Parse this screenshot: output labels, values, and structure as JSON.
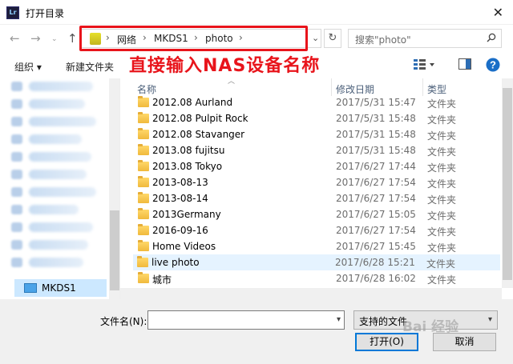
{
  "window": {
    "title": "打开目录",
    "app_icon_text": "Lr"
  },
  "nav": {
    "breadcrumb": [
      "网络",
      "MKDS1",
      "photo"
    ],
    "search_placeholder": "搜索\"photo\""
  },
  "toolbar": {
    "organize": "组织 ▾",
    "new_folder": "新建文件夹",
    "annotation": "直接输入NAS设备名称"
  },
  "sidebar": {
    "selected_item": "MKDS1"
  },
  "columns": {
    "name": "名称",
    "date": "修改日期",
    "type": "类型"
  },
  "files": [
    {
      "name": "2012.08 Aurland",
      "date": "2017/5/31 15:47",
      "type": "文件夹"
    },
    {
      "name": "2012.08 Pulpit Rock",
      "date": "2017/5/31 15:48",
      "type": "文件夹"
    },
    {
      "name": "2012.08 Stavanger",
      "date": "2017/5/31 15:48",
      "type": "文件夹"
    },
    {
      "name": "2013.08 fujitsu",
      "date": "2017/5/31 15:48",
      "type": "文件夹"
    },
    {
      "name": "2013.08 Tokyo",
      "date": "2017/6/27 17:44",
      "type": "文件夹"
    },
    {
      "name": "2013-08-13",
      "date": "2017/6/27 17:54",
      "type": "文件夹"
    },
    {
      "name": "2013-08-14",
      "date": "2017/6/27 17:54",
      "type": "文件夹"
    },
    {
      "name": "2013Germany",
      "date": "2017/6/27 15:05",
      "type": "文件夹"
    },
    {
      "name": "2016-09-16",
      "date": "2017/6/27 17:54",
      "type": "文件夹"
    },
    {
      "name": "Home Videos",
      "date": "2017/6/27 15:45",
      "type": "文件夹"
    },
    {
      "name": "live photo",
      "date": "2017/6/28 15:21",
      "type": "文件夹",
      "selected": true
    },
    {
      "name": "城市",
      "date": "2017/6/28 16:02",
      "type": "文件夹"
    }
  ],
  "bottom": {
    "filename_label": "文件名(N):",
    "filename_value": "",
    "filetype": "支持的文件",
    "open_button": "打开(O)",
    "cancel_button": "取消",
    "watermark": "Bai 经验"
  },
  "colors": {
    "accent": "#0078d7",
    "annotation": "#e8141b",
    "selection": "#cce8ff"
  }
}
